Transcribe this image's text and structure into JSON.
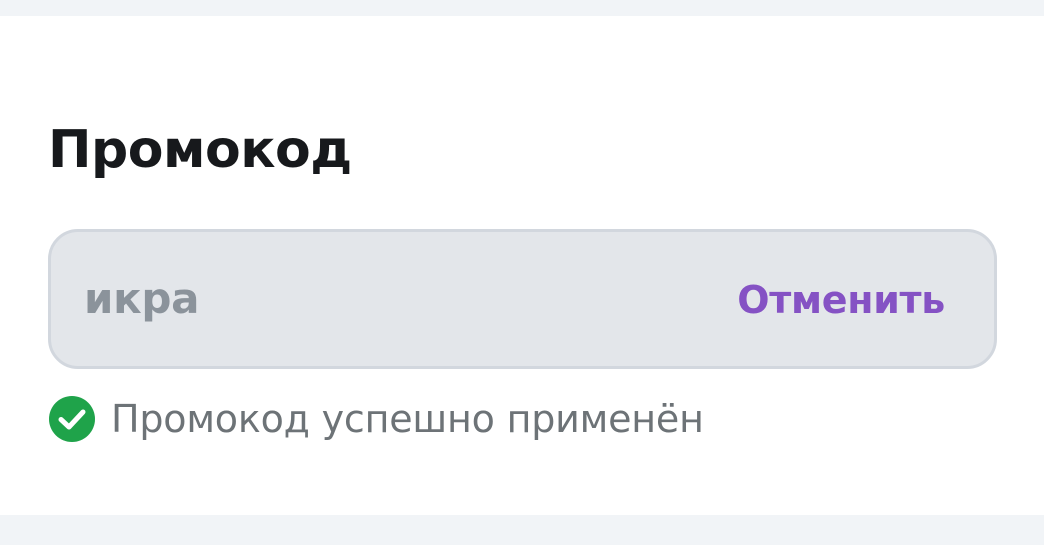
{
  "promo": {
    "title": "Промокод",
    "value": "икра",
    "cancel_label": "Отменить",
    "status_text": "Промокод успешно применён",
    "status_icon": "check-circle-icon"
  },
  "colors": {
    "accent": "#8552c4",
    "success": "#1fa34a"
  }
}
